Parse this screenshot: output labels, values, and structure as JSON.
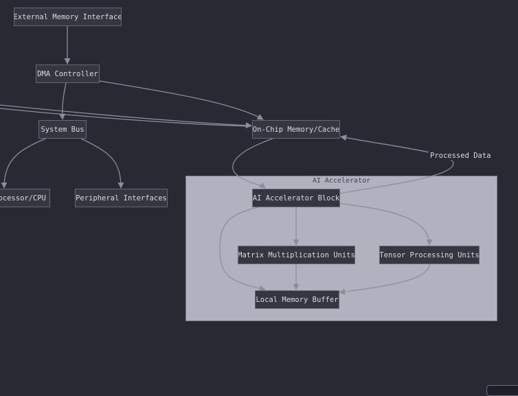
{
  "diagram": {
    "subgraph": {
      "title": "AI Accelerator"
    },
    "nodes": {
      "external_memory": "External Memory Interface",
      "dma_controller": "DMA Controller",
      "system_bus": "System Bus",
      "on_chip_memory": "On-Chip Memory/Cache",
      "processor_cpu": "rocessor/CPU",
      "peripheral_interfaces": "Peripheral Interfaces",
      "ai_accelerator_block": "AI Accelerator Block",
      "matrix_units": "Matrix Multiplication Units",
      "tensor_units": "Tensor Processing Units",
      "local_memory_buffer": "Local Memory Buffer"
    },
    "edge_labels": {
      "processed_data": "Processed Data"
    },
    "colors": {
      "background": "#282a33",
      "node_fill": "#343640",
      "node_border": "#656876",
      "edge": "#8a8d9b",
      "subgraph_fill": "#b0b3bf",
      "text": "#d9dbe3"
    }
  }
}
